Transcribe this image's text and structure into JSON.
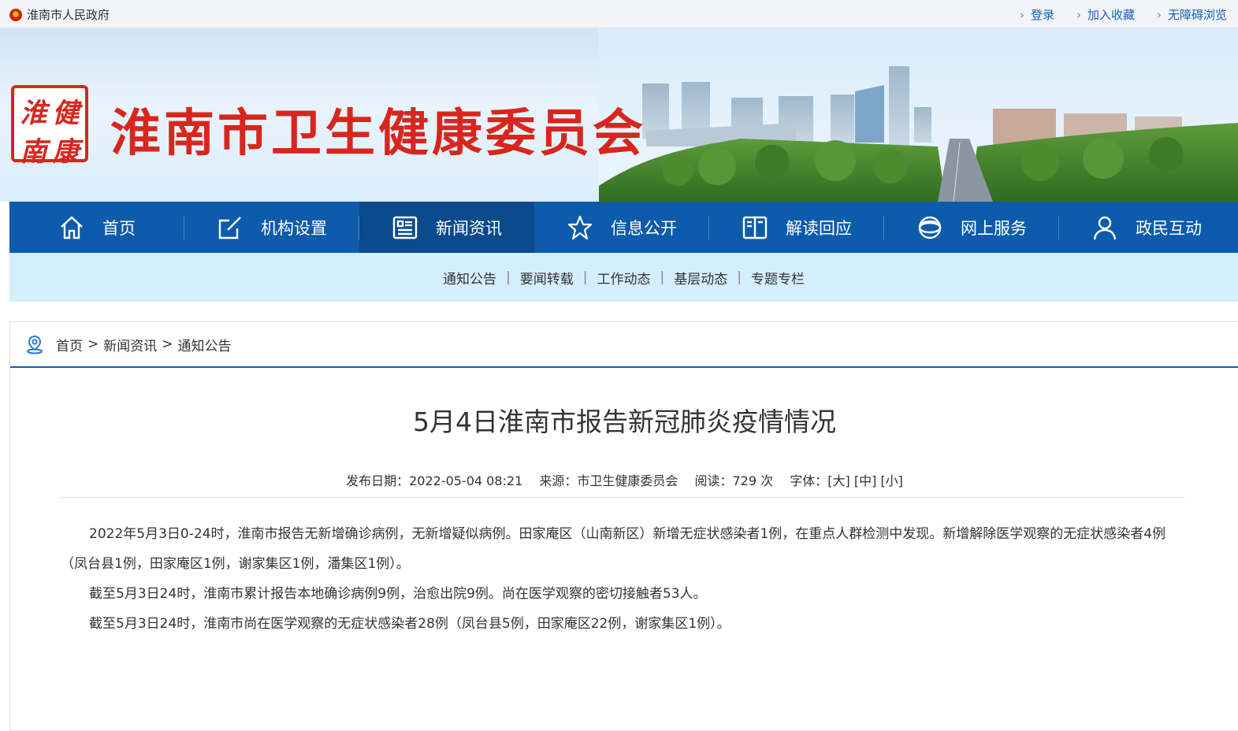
{
  "topbar": {
    "gov_name": "淮南市人民政府",
    "links": [
      "登录",
      "加入收藏",
      "无障碍浏览"
    ]
  },
  "header": {
    "logo_chars": [
      "淮",
      "健",
      "南",
      "康"
    ],
    "site_title": "淮南市卫生健康委员会"
  },
  "nav": {
    "items": [
      {
        "label": "首页",
        "icon": "home-icon"
      },
      {
        "label": "机构设置",
        "icon": "edit-icon"
      },
      {
        "label": "新闻资讯",
        "icon": "news-icon"
      },
      {
        "label": "信息公开",
        "icon": "star-icon"
      },
      {
        "label": "解读回应",
        "icon": "book-icon"
      },
      {
        "label": "网上服务",
        "icon": "globe-icon"
      },
      {
        "label": "政民互动",
        "icon": "user-icon"
      }
    ],
    "active_index": 2
  },
  "subnav": [
    "通知公告",
    "要闻转载",
    "工作动态",
    "基层动态",
    "专题专栏"
  ],
  "breadcrumb": [
    "首页",
    "新闻资讯",
    "通知公告"
  ],
  "article": {
    "title": "5月4日淮南市报告新冠肺炎疫情情况",
    "date_label": "发布日期：",
    "date": "2022-05-04 08:21",
    "source_label": "来源：",
    "source": "市卫生健康委员会",
    "views_label": "阅读：",
    "views": "729 次",
    "font_label": "字体：",
    "font_large": "[大]",
    "font_medium": "[中]",
    "font_small": "[小]",
    "paragraphs": [
      "2022年5月3日0-24时，淮南市报告无新增确诊病例，无新增疑似病例。田家庵区（山南新区）新增无症状感染者1例，在重点人群检测中发现。新增解除医学观察的无症状感染者4例（凤台县1例，田家庵区1例，谢家集区1例，潘集区1例）。",
      "截至5月3日24时，淮南市累计报告本地确诊病例9例，治愈出院9例。尚在医学观察的密切接触者53人。",
      "截至5月3日24时，淮南市尚在医学观察的无症状感染者28例（凤台县5例，田家庵区22例，谢家集区1例）。"
    ]
  },
  "colors": {
    "nav_bg": "#0d5cab",
    "nav_active": "#0b4a8c",
    "subnav_bg": "#d5eefc",
    "brand_red": "#d7261e",
    "link_blue": "#1a5fb4"
  }
}
